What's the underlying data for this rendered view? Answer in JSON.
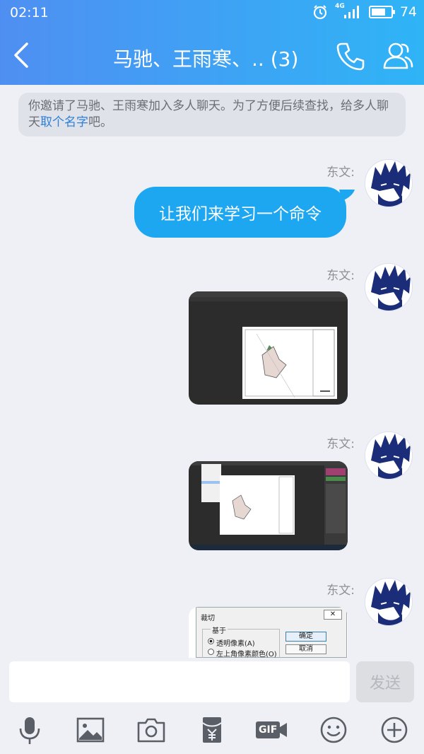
{
  "status": {
    "time": "02:11",
    "network": "4G",
    "battery": "74",
    "battery_level": 0.74
  },
  "header": {
    "title": "马驰、王雨寒、.. (3)"
  },
  "notice": {
    "prefix": "你邀请了马驰、王雨寒加入多人聊天。为了方便后续查找，给多人聊天",
    "link": "取个名字",
    "suffix": "吧。"
  },
  "messages": [
    {
      "sender": "东文:",
      "type": "text",
      "text": "让我们来学习一个命令"
    },
    {
      "sender": "东文:",
      "type": "image"
    },
    {
      "sender": "东文:",
      "type": "image"
    },
    {
      "sender": "东文:",
      "type": "image",
      "dialog": {
        "title": "裁切",
        "group": "基于",
        "option1": "透明像素(A)",
        "option2": "左上角像素颜色(O)",
        "ok": "确定",
        "cancel": "取消"
      }
    }
  ],
  "input": {
    "placeholder": "",
    "send_label": "发送"
  },
  "toolbar": {
    "gif_label": "GIF",
    "icons": [
      "microphone-icon",
      "image-icon",
      "camera-icon",
      "red-packet-icon",
      "gif-icon",
      "emoji-icon",
      "plus-icon"
    ]
  },
  "colors": {
    "header_start": "#4f8ff2",
    "header_end": "#2fb4f6",
    "bubble": "#1ea7f1",
    "link": "#2e7fd8"
  }
}
